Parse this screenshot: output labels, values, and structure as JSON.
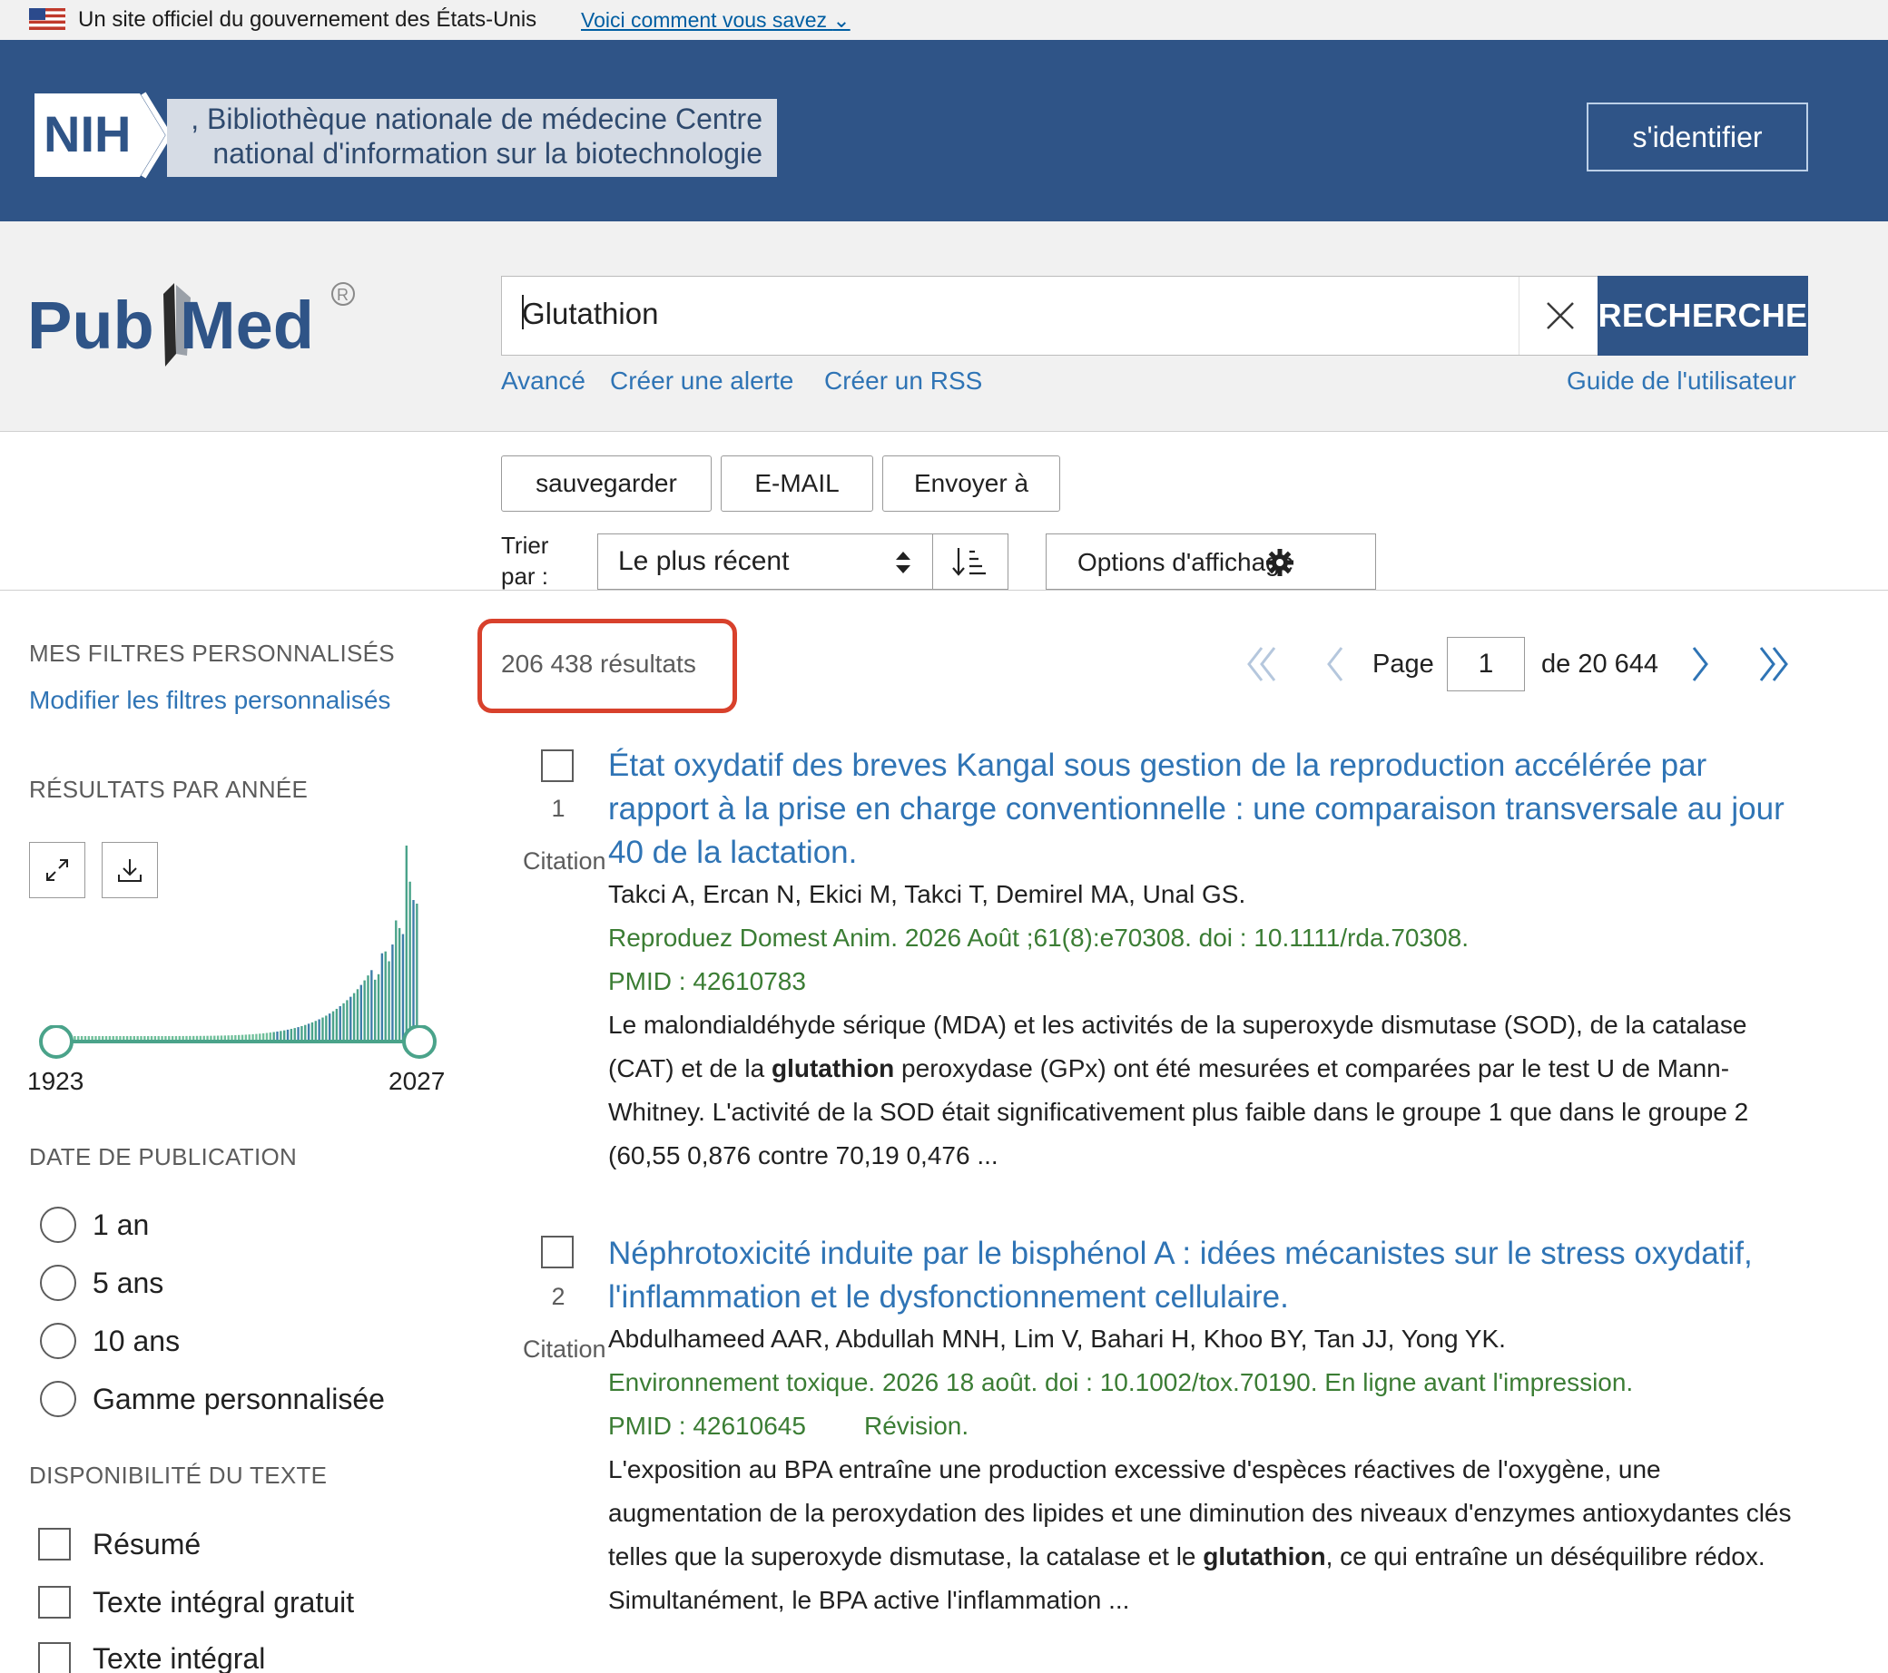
{
  "gov_banner": {
    "text": "Un site officiel du gouvernement des États-Unis",
    "how_link": "Voici comment vous savez"
  },
  "nih": {
    "logo_text": "NIH",
    "name_line1": ", Bibliothèque nationale de médecine Centre",
    "name_line2": "national d'information sur la biotechnologie",
    "login": "s'identifier"
  },
  "pubmed": {
    "logo": "PubMed",
    "search_value": "Glutathion",
    "search_button": "RECHERCHE",
    "links": {
      "advanced": "Avancé",
      "alert": "Créer une alerte",
      "rss": "Créer un RSS",
      "guide": "Guide de l'utilisateur"
    }
  },
  "toolbar": {
    "save": "sauvegarder",
    "email": "E-MAIL",
    "send_to": "Envoyer à",
    "sort_label_1": "Trier",
    "sort_label_2": "par :",
    "sort_value": "Le plus récent",
    "display_options": "Options d'affichage"
  },
  "sidebar": {
    "my_filters_heading": "MES FILTRES PERSONNALISÉS",
    "edit_filters": "Modifier les filtres personnalisés",
    "results_by_year_heading": "RÉSULTATS PAR ANNÉE",
    "year_start": "1923",
    "year_end": "2027",
    "pub_date_heading": "DATE DE PUBLICATION",
    "pub_date_options": [
      "1 an",
      "5 ans",
      "10 ans",
      "Gamme personnalisée"
    ],
    "text_avail_heading": "DISPONIBILITÉ DU TEXTE",
    "text_avail_options": [
      "Résumé",
      "Texte intégral gratuit",
      "Texte intégral"
    ]
  },
  "results": {
    "count": "206 438 résultats",
    "page_label": "Page",
    "page_value": "1",
    "page_total": "de 20 644",
    "items": [
      {
        "number": "1",
        "citation": "Citation",
        "title": "État oxydatif des breves Kangal sous gestion de la reproduction accélérée par rapport à la prise en charge conventionnelle : une comparaison transversale au jour 40 de la lactation.",
        "authors": "Takci A, Ercan N, Ekici M, Takci T, Demirel MA, Unal GS.",
        "journal": "Reproduez Domest Anim. 2026 Août ;61(8):e70308. doi : 10.1111/rda.70308.",
        "pmid": "PMID : 42610783",
        "snippet_before": "Le malondialdéhyde sérique (MDA) et les activités de la superoxyde dismutase (SOD), de la catalase (CAT) et de la ",
        "snippet_bold": "glutathion",
        "snippet_after": " peroxydase (GPx) ont été mesurées et comparées par le test U de Mann-Whitney. L'activité de la SOD était significativement plus faible dans le groupe 1 que dans le groupe 2 (60,55 0,876 contre 70,19 0,476 ..."
      },
      {
        "number": "2",
        "citation": "Citation",
        "title": "Néphrotoxicité induite par le bisphénol A : idées mécanistes sur le stress oxydatif, l'inflammation et le dysfonctionnement cellulaire.",
        "authors": "Abdulhameed AAR, Abdullah MNH, Lim V, Bahari H, Khoo BY, Tan JJ, Yong YK.",
        "journal": "Environnement toxique. 2026 18 août. doi : 10.1002/tox.70190. En ligne avant l'impression.",
        "pmid": "PMID : 42610645",
        "review": "Révision.",
        "snippet_before": "L'exposition au BPA entraîne une production excessive d'espèces réactives de l'oxygène, une augmentation de la peroxydation des lipides et une diminution des niveaux d'enzymes antioxydantes clés telles que la superoxyde dismutase, la catalase et le ",
        "snippet_bold": "glutathion",
        "snippet_after": ", ce qui entraîne un déséquilibre rédox. Simultanément, le BPA active l'inflammation ..."
      }
    ]
  },
  "colors": {
    "nih_blue": "#2f5487",
    "link_blue": "#2f74b5",
    "journal_green": "#3b7d34",
    "highlight_red": "#d8412c",
    "chart_teal": "#4aa38a"
  }
}
